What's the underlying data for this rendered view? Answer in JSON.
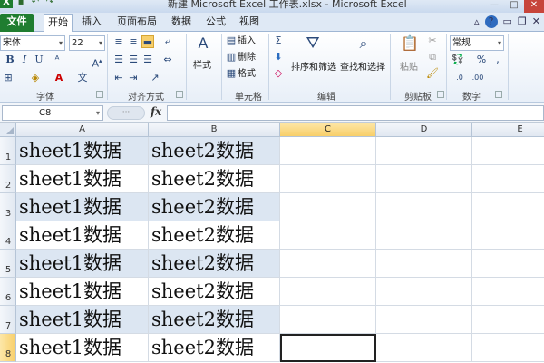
{
  "title_bar": {
    "title": "新建 Microsoft Excel 工作表.xlsx - Microsoft Excel",
    "qat_save": "▪",
    "qat_undo": "↶",
    "qat_redo": "↷",
    "min": "—",
    "max": "□",
    "close": "✕"
  },
  "tabs": [
    {
      "label": "文件",
      "name": "tab-file"
    },
    {
      "label": "开始",
      "name": "tab-home"
    },
    {
      "label": "插入",
      "name": "tab-insert"
    },
    {
      "label": "页面布局",
      "name": "tab-page-layout"
    },
    {
      "label": "数据",
      "name": "tab-data"
    },
    {
      "label": "公式",
      "name": "tab-formulas"
    },
    {
      "label": "视图",
      "name": "tab-view"
    }
  ],
  "ribbon": {
    "font_name": "宋体",
    "font_size": "22",
    "bold": "B",
    "italic": "I",
    "underline": "U",
    "style_label": "样式",
    "insert_label": "插入",
    "delete_label": "删除",
    "format_label": "格式",
    "sort_filter_label": "排序和筛选",
    "find_select_label": "查找和选择",
    "paste_label": "粘贴",
    "number_format": "常规",
    "percent": "%",
    "comma": ",",
    "groups": {
      "font": "字体",
      "alignment": "对齐方式",
      "cells": "单元格",
      "editing": "编辑",
      "clipboard": "剪贴板",
      "number": "数字"
    }
  },
  "formula_bar": {
    "name_box": "C8",
    "fx": "fx",
    "formula": ""
  },
  "grid": {
    "columns": [
      "A",
      "B",
      "C",
      "D",
      "E"
    ],
    "selected_column": "C",
    "selected_row": "8",
    "active_cell": "C8",
    "rows": [
      {
        "num": "1",
        "a": "sheet1数据",
        "b": "sheet2数据",
        "band": true
      },
      {
        "num": "2",
        "a": "sheet1数据",
        "b": "sheet2数据",
        "band": false
      },
      {
        "num": "3",
        "a": "sheet1数据",
        "b": "sheet2数据",
        "band": true
      },
      {
        "num": "4",
        "a": "sheet1数据",
        "b": "sheet2数据",
        "band": false
      },
      {
        "num": "5",
        "a": "sheet1数据",
        "b": "sheet2数据",
        "band": true
      },
      {
        "num": "6",
        "a": "sheet1数据",
        "b": "sheet2数据",
        "band": false
      },
      {
        "num": "7",
        "a": "sheet1数据",
        "b": "sheet2数据",
        "band": true
      },
      {
        "num": "8",
        "a": "sheet1数据",
        "b": "sheet2数据",
        "band": false
      }
    ]
  },
  "colors": {
    "file_tab": "#1f7d30",
    "band": "#dce6f2",
    "selected_header": "#f8cf6a"
  }
}
